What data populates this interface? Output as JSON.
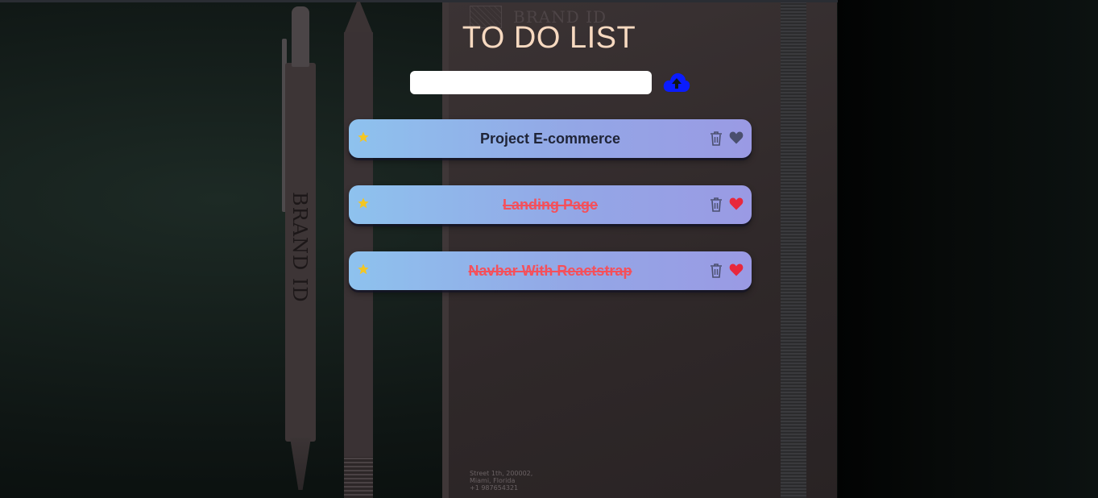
{
  "app": {
    "title": "TO DO LIST"
  },
  "add_form": {
    "input_value": "",
    "input_placeholder": "",
    "upload_icon": "cloud-upload-icon",
    "upload_color": "#0a1cff"
  },
  "todos": [
    {
      "text": "Project E-commerce",
      "completed": false,
      "favorite": false
    },
    {
      "text": "Landing Page",
      "completed": true,
      "favorite": true
    },
    {
      "text": "Navbar With Reactstrap",
      "completed": true,
      "favorite": true
    }
  ],
  "icons": {
    "star": "star-icon",
    "delete": "trash-icon",
    "favorite": "heart-icon"
  },
  "colors": {
    "title": "#f7d9c0",
    "star": "#f3c623",
    "heart_active": "#e8283c",
    "heart_inactive": "#4a4f6e",
    "done_text": "#f4505b"
  },
  "background": {
    "notebook_brand": "BRAND ID",
    "pen_brand": "BRAND ID",
    "address_lines": [
      "Street 1th, 200002,",
      "Miami, Florida",
      "+1 987654321"
    ]
  }
}
